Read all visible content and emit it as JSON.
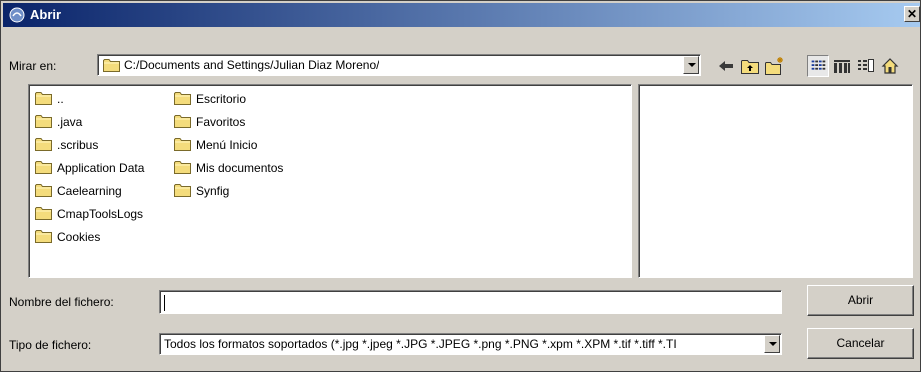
{
  "window": {
    "title": "Abrir"
  },
  "look_in": {
    "label": "Mirar en:",
    "path": "C:/Documents and Settings/Julian Diaz Moreno/"
  },
  "toolbar": {
    "buttons": [
      {
        "name": "back-icon"
      },
      {
        "name": "up-folder-icon"
      },
      {
        "name": "new-folder-icon"
      },
      {
        "name": "list-view-icon"
      },
      {
        "name": "details-view-icon"
      },
      {
        "name": "preview-icon"
      },
      {
        "name": "home-icon"
      }
    ]
  },
  "files": {
    "column1": [
      "..",
      ".java",
      ".scribus",
      "Application Data",
      "Caelearning",
      "CmapToolsLogs",
      "Cookies"
    ],
    "column2": [
      "Escritorio",
      "Favoritos",
      "Menú Inicio",
      "Mis documentos",
      "Synfig"
    ]
  },
  "filename": {
    "label": "Nombre del fichero:",
    "value": ""
  },
  "filetype": {
    "label": "Tipo de fichero:",
    "value": "Todos los formatos soportados (*.jpg *.jpeg *.JPG *.JPEG *.png *.PNG *.xpm *.XPM *.tif *.tiff *.TI"
  },
  "buttons": {
    "open": "Abrir",
    "cancel": "Cancelar"
  },
  "colors": {
    "title_start": "#0a246a",
    "title_end": "#a6caf0",
    "folder": "#f4dc7c",
    "face": "#d4d0c8"
  }
}
